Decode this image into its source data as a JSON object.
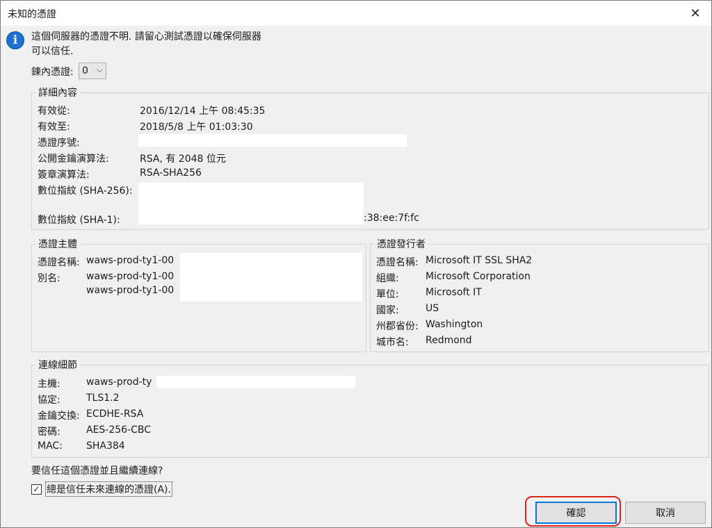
{
  "window": {
    "title": "未知的憑證"
  },
  "message": "這個伺服器的憑證不明. 請留心測試憑證以確保伺服器可以信任.",
  "chain": {
    "label": "鍊內憑證:",
    "selected": "0"
  },
  "details": {
    "legend": "詳細內容",
    "valid_from_label": "有效從:",
    "valid_from": "2016/12/14 上午 08:45:35",
    "valid_to_label": "有效至:",
    "valid_to": "2018/5/8 上午 01:03:30",
    "serial_label": "憑證序號:",
    "pubkey_label": "公開金鑰演算法:",
    "pubkey": "RSA, 有 2048 位元",
    "sigalg_label": "簽章演算法:",
    "sigalg": "RSA-SHA256",
    "fp256_label": "數位指紋 (SHA-256):",
    "fp1_label": "數位指紋 (SHA-1):",
    "fp1_tail": ":38:ee:7f:fc"
  },
  "subject": {
    "legend": "憑證主體",
    "name_label": "憑證名稱:",
    "name": "waws-prod-ty1-00",
    "alias_label": "別名:",
    "alias1": "waws-prod-ty1-00",
    "alias2": "waws-prod-ty1-00"
  },
  "issuer": {
    "legend": "憑證發行者",
    "name_label": "憑證名稱:",
    "name": "Microsoft IT SSL SHA2",
    "org_label": "組織:",
    "org": "Microsoft Corporation",
    "unit_label": "單位:",
    "unit": "Microsoft IT",
    "country_label": "國家:",
    "country": "US",
    "state_label": "州郡省份:",
    "state": "Washington",
    "city_label": "城市名:",
    "city": "Redmond"
  },
  "connection": {
    "legend": "連線細節",
    "host_label": "主機:",
    "host": "waws-prod-ty",
    "protocol_label": "協定:",
    "protocol": "TLS1.2",
    "kex_label": "金鑰交換:",
    "kex": "ECDHE-RSA",
    "cipher_label": "密碼:",
    "cipher": "AES-256-CBC",
    "mac_label": "MAC:",
    "mac": "SHA384"
  },
  "question": "要信任這個憑證並且繼續連線?",
  "always_trust": {
    "label": "總是信任未來連線的憑證(A).",
    "checked": true
  },
  "buttons": {
    "ok": "確認",
    "cancel": "取消"
  },
  "colors": {
    "accent": "#0078d7",
    "highlight": "#e0201a",
    "info_icon": "#1f6fd1"
  }
}
